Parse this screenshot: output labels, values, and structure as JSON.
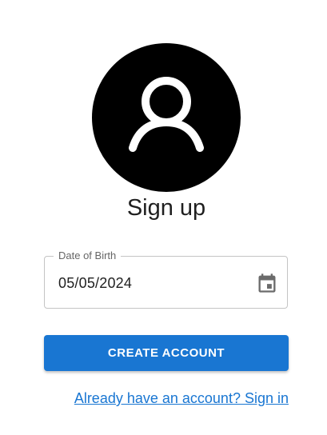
{
  "header": {
    "avatar_icon": "person-outline-icon",
    "avatar_background": "#000000",
    "title": "Sign up"
  },
  "form": {
    "dob_field": {
      "label": "Date of Birth",
      "value": "05/05/2024",
      "icon": "calendar-icon"
    },
    "submit_label": "CREATE ACCOUNT",
    "submit_color": "#1976d2"
  },
  "footer": {
    "signin_link": "Already have an account? Sign in",
    "link_color": "#1976d2"
  }
}
